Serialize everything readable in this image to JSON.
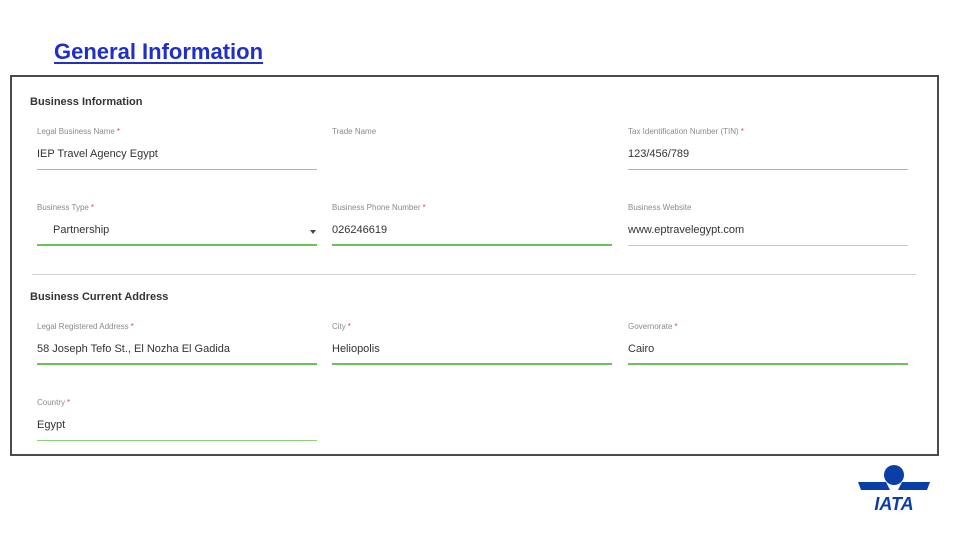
{
  "slide": {
    "title": "General Information"
  },
  "business_info": {
    "title": "Business Information",
    "legal_name": {
      "label": "Legal Business Name",
      "required": "*",
      "value": "IEP Travel Agency Egypt"
    },
    "trade_name": {
      "label": "Trade Name",
      "value": ""
    },
    "tin": {
      "label": "Tax Identification Number (TIN)",
      "required": "*",
      "value": "123/456/789"
    },
    "business_type": {
      "label": "Business Type",
      "required": "*",
      "value": "Partnership"
    },
    "phone": {
      "label": "Business Phone Number",
      "required": "*",
      "value": "026246619"
    },
    "website": {
      "label": "Business Website",
      "value": "www.eptravelegypt.com"
    }
  },
  "current_address": {
    "title": "Business Current Address",
    "legal_address": {
      "label": "Legal Registered Address",
      "required": "*",
      "value": "58 Joseph Tefo St., El Nozha El Gadida"
    },
    "city": {
      "label": "City",
      "required": "*",
      "value": "Heliopolis"
    },
    "governorate": {
      "label": "Governorate",
      "required": "*",
      "value": "Cairo"
    },
    "country": {
      "label": "Country",
      "required": "*",
      "value": "Egypt"
    }
  },
  "logo": {
    "text": "IATA",
    "color": "#0b3fa8"
  },
  "colors": {
    "title": "#1f2fc8",
    "underline_active": "#6cc05a",
    "required": "#e04848"
  }
}
